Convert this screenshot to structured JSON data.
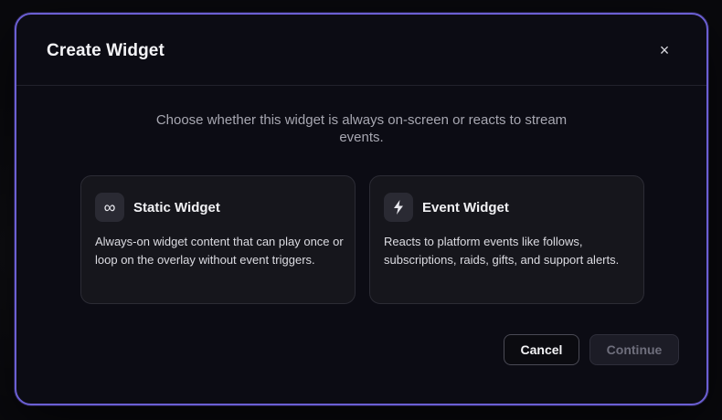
{
  "modal": {
    "title": "Create Widget",
    "close_symbol": "×",
    "description": "Choose whether this widget is always on-screen or reacts to stream events."
  },
  "options": [
    {
      "icon": "infinity-icon",
      "icon_glyph": "∞",
      "title": "Static Widget",
      "description": "Always-on widget content that can play once or loop on the overlay without event triggers."
    },
    {
      "icon": "lightning-bolt-icon",
      "title": "Event Widget",
      "description": "Reacts to platform events like follows, subscriptions, raids, gifts, and support alerts."
    }
  ],
  "actions": {
    "cancel_label": "Cancel",
    "continue_label": "Continue",
    "continue_disabled": true
  },
  "colors": {
    "accent_border": "#6b5fd3",
    "modal_background": "#0c0c14",
    "card_background": "#16161c"
  }
}
